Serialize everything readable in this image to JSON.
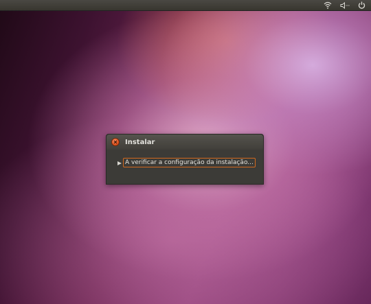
{
  "panel": {
    "indicators": [
      {
        "icon": "wifi-icon"
      },
      {
        "icon": "volume-icon"
      },
      {
        "icon": "power-icon"
      }
    ]
  },
  "dialog": {
    "title": "Instalar",
    "close_icon": "close-icon",
    "expander_label": "A verificar a configuração da instalação..."
  },
  "colors": {
    "accent": "#e2541e",
    "panel_bg": "#3c3b37",
    "focus_border": "#d2691e"
  }
}
